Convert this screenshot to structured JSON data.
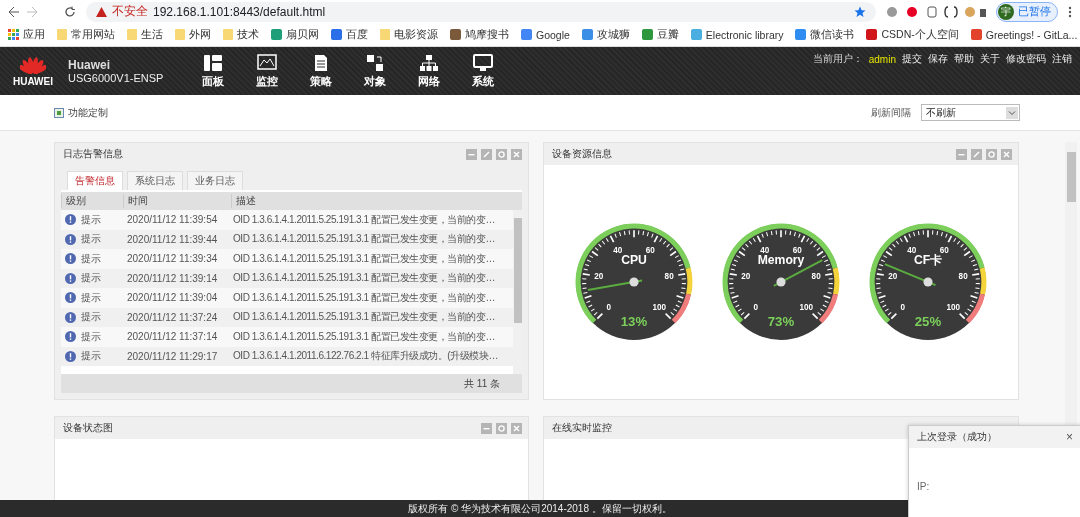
{
  "browser": {
    "warning": "不安全",
    "url": "192.168.1.101:8443/default.html",
    "profile_initial": "宇",
    "profile": "已暂停",
    "bookmarks": [
      {
        "label": "应用",
        "kind": "apps"
      },
      {
        "label": "常用网站",
        "kind": "folder"
      },
      {
        "label": "生活",
        "kind": "folder"
      },
      {
        "label": "外网",
        "kind": "folder"
      },
      {
        "label": "技术",
        "kind": "folder"
      },
      {
        "label": "扇贝网",
        "kind": "site",
        "color": "#1f9e7a"
      },
      {
        "label": "百度",
        "kind": "site",
        "color": "#2a6ee8"
      },
      {
        "label": "电影资源",
        "kind": "folder"
      },
      {
        "label": "鸠摩搜书",
        "kind": "site",
        "color": "#7a5a3a"
      },
      {
        "label": "Google",
        "kind": "site",
        "color": "#4285f4"
      },
      {
        "label": "攻城狮",
        "kind": "site",
        "color": "#3a8ee6"
      },
      {
        "label": "豆瓣",
        "kind": "site",
        "color": "#2e963d"
      },
      {
        "label": "Electronic library",
        "kind": "site",
        "color": "#4aaee0"
      },
      {
        "label": "微信读书",
        "kind": "site",
        "color": "#2f8cf0"
      },
      {
        "label": "CSDN-个人空间",
        "kind": "site",
        "color": "#d0161b"
      },
      {
        "label": "Greetings! - GitLa...",
        "kind": "site",
        "color": "#e2432a"
      }
    ]
  },
  "header": {
    "logo_text": "HUAWEI",
    "brand": "Huawei",
    "model": "USG6000V1-ENSP",
    "nav": [
      {
        "label": "面板",
        "kind": "dashboard"
      },
      {
        "label": "监控",
        "kind": "monitor"
      },
      {
        "label": "策略",
        "kind": "policy"
      },
      {
        "label": "对象",
        "kind": "object"
      },
      {
        "label": "网络",
        "kind": "network"
      },
      {
        "label": "系统",
        "kind": "system"
      }
    ],
    "user_label": "当前用户：",
    "user": "admin",
    "links": [
      "提交",
      "保存",
      "帮助",
      "关于",
      "修改密码",
      "注销"
    ]
  },
  "toolbar": {
    "customize": "功能定制",
    "refresh_label": "刷新间隔",
    "refresh_value": "不刷新"
  },
  "log_panel": {
    "title": "日志告警信息",
    "tabs": [
      {
        "label": "告警信息",
        "selected": true
      },
      {
        "label": "系统日志",
        "selected": false
      },
      {
        "label": "业务日志",
        "selected": false
      }
    ],
    "columns": [
      "级别",
      "时间",
      "描述"
    ],
    "rows": [
      {
        "level": "提示",
        "time": "2020/11/12 11:39:54",
        "desc": "OID 1.3.6.1.4.1.2011.5.25.191.3.1 配置已发生变更，当前的变…"
      },
      {
        "level": "提示",
        "time": "2020/11/12 11:39:44",
        "desc": "OID 1.3.6.1.4.1.2011.5.25.191.3.1 配置已发生变更，当前的变…"
      },
      {
        "level": "提示",
        "time": "2020/11/12 11:39:34",
        "desc": "OID 1.3.6.1.4.1.2011.5.25.191.3.1 配置已发生变更，当前的变…"
      },
      {
        "level": "提示",
        "time": "2020/11/12 11:39:14",
        "desc": "OID 1.3.6.1.4.1.2011.5.25.191.3.1 配置已发生变更，当前的变…"
      },
      {
        "level": "提示",
        "time": "2020/11/12 11:39:04",
        "desc": "OID 1.3.6.1.4.1.2011.5.25.191.3.1 配置已发生变更，当前的变…"
      },
      {
        "level": "提示",
        "time": "2020/11/12 11:37:24",
        "desc": "OID 1.3.6.1.4.1.2011.5.25.191.3.1 配置已发生变更，当前的变…"
      },
      {
        "level": "提示",
        "time": "2020/11/12 11:37:14",
        "desc": "OID 1.3.6.1.4.1.2011.5.25.191.3.1 配置已发生变更，当前的变…"
      },
      {
        "level": "提示",
        "time": "2020/11/12 11:29:17",
        "desc": "OID 1.3.6.1.4.1.2011.6.122.76.2.1 特征库升级成功。(升级模块…"
      }
    ],
    "total": "共 11 条"
  },
  "resource_panel": {
    "title": "设备资源信息",
    "gauges": [
      {
        "name": "CPU",
        "level": 0.13,
        "reading": "13%",
        "ticks": [
          "0",
          "20",
          "40",
          "60",
          "80",
          "100"
        ]
      },
      {
        "name": "Memory",
        "level": 0.73,
        "reading": "73%",
        "ticks": [
          "0",
          "20",
          "40",
          "60",
          "80",
          "100"
        ]
      },
      {
        "name": "CF卡",
        "level": 0.25,
        "reading": "25%",
        "ticks": [
          "0",
          "20",
          "40",
          "60",
          "80",
          "100"
        ]
      }
    ]
  },
  "status_panel": {
    "title": "设备状态图"
  },
  "monitor_panel": {
    "title": "在线实时监控"
  },
  "login_popup": {
    "title": "上次登录（成功）",
    "ip_label": "IP:",
    "close": "×"
  },
  "footer": "版权所有 © 华为技术有限公司2014-2018 。保留一切权利。"
}
